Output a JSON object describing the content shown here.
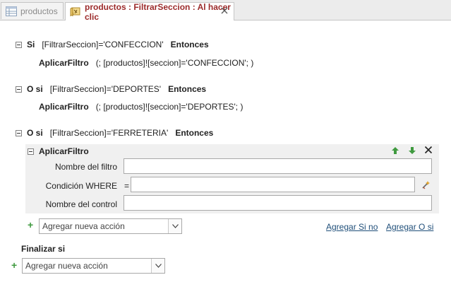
{
  "tabs": [
    {
      "label": "productos"
    },
    {
      "label": "productos : FiltrarSeccion : Al hacer clic"
    }
  ],
  "blocks": {
    "if1": {
      "keyword": "Si",
      "condition": "[FiltrarSeccion]='CONFECCION'",
      "then": "Entonces",
      "action": "AplicarFiltro",
      "args": "(; [productos]![seccion]='CONFECCION'; )"
    },
    "elseif1": {
      "keyword": "O si",
      "condition": "[FiltrarSeccion]='DEPORTES'",
      "then": "Entonces",
      "action": "AplicarFiltro",
      "args": "(; [productos]![seccion]='DEPORTES'; )"
    },
    "elseif2": {
      "keyword": "O si",
      "condition": "[FiltrarSeccion]='FERRETERIA'",
      "then": "Entonces"
    }
  },
  "action_editor": {
    "title": "AplicarFiltro",
    "fields": {
      "filter_name": {
        "label": "Nombre del filtro",
        "value": ""
      },
      "where": {
        "label": "Condición WHERE",
        "prefix": "=",
        "value": ""
      },
      "control_name": {
        "label": "Nombre del control",
        "value": ""
      }
    }
  },
  "add_action": {
    "value": "Agregar nueva acción"
  },
  "links": {
    "add_else": "Agregar Si no",
    "add_elseif": "Agregar O si"
  },
  "end_if": {
    "label": "Finalizar si",
    "add_action": "Agregar nueva acción"
  },
  "colors": {
    "tab_title": "#9c2b2b",
    "link": "#1f4e79",
    "arrow_green": "#3f9a3f"
  }
}
